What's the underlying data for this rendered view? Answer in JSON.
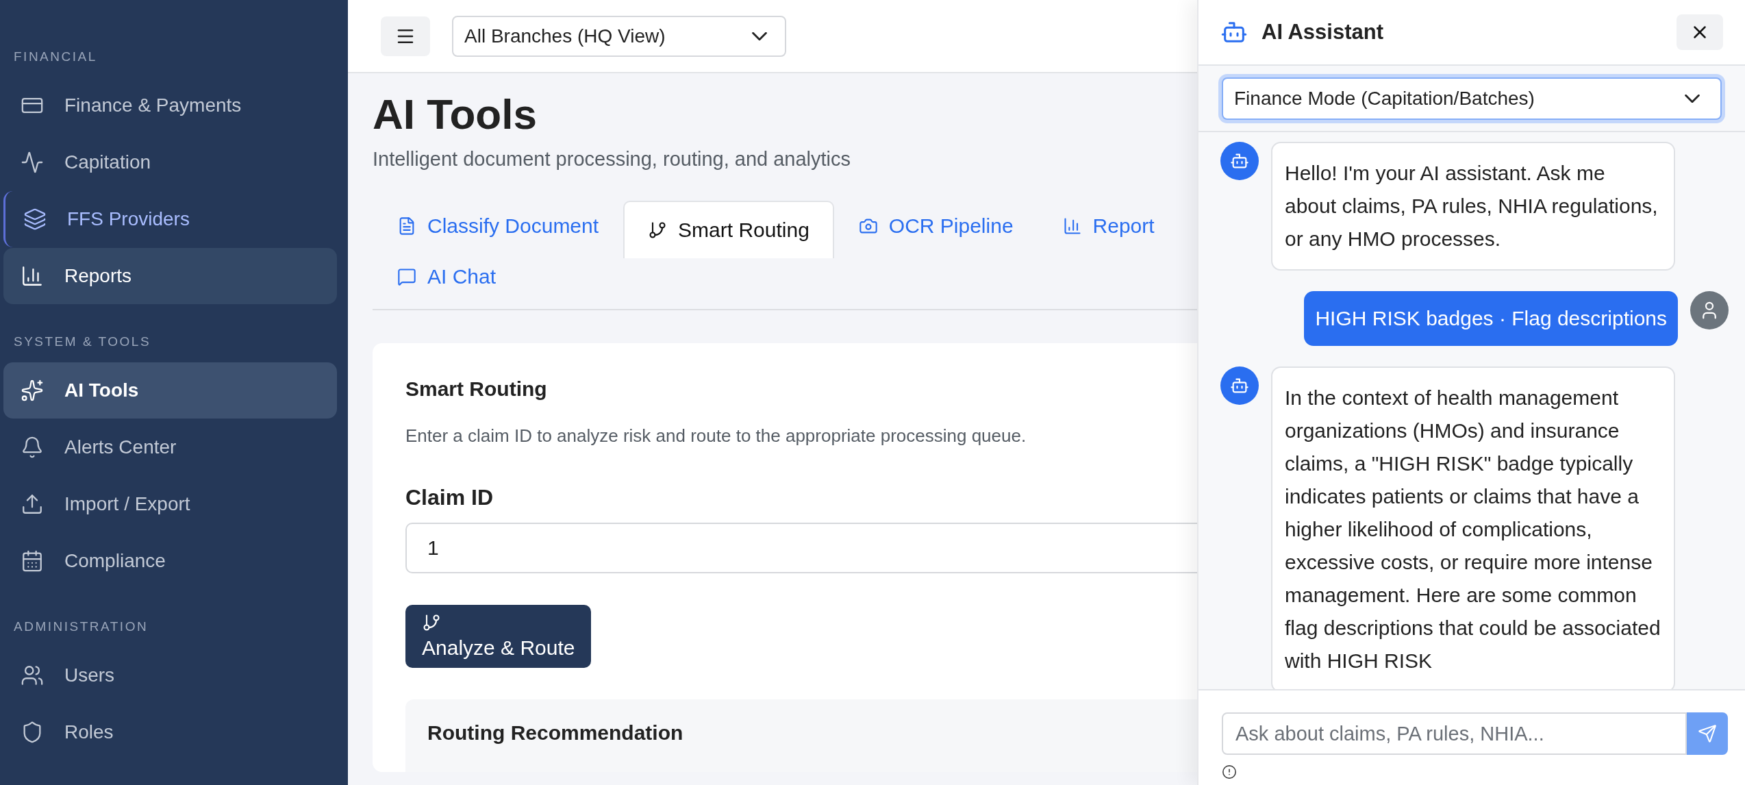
{
  "sidebar": {
    "sections": [
      {
        "title": "FINANCIAL",
        "items": [
          {
            "label": "Finance & Payments",
            "selected": false,
            "hovered": false,
            "focused": false
          },
          {
            "label": "Capitation",
            "selected": false,
            "hovered": false,
            "focused": false
          },
          {
            "label": "FFS Providers",
            "selected": false,
            "hovered": false,
            "focused": true
          },
          {
            "label": "Reports",
            "selected": false,
            "hovered": true,
            "focused": false
          }
        ]
      },
      {
        "title": "SYSTEM & TOOLS",
        "items": [
          {
            "label": "AI Tools",
            "selected": true,
            "hovered": false,
            "focused": false
          },
          {
            "label": "Alerts Center",
            "selected": false,
            "hovered": false,
            "focused": false
          },
          {
            "label": "Import / Export",
            "selected": false,
            "hovered": false,
            "focused": false
          },
          {
            "label": "Compliance",
            "selected": false,
            "hovered": false,
            "focused": false
          }
        ]
      },
      {
        "title": "ADMINISTRATION",
        "items": [
          {
            "label": "Users",
            "selected": false,
            "hovered": false,
            "focused": false
          },
          {
            "label": "Roles",
            "selected": false,
            "hovered": false,
            "focused": false
          }
        ]
      }
    ]
  },
  "topbar": {
    "branch_select": {
      "value": "All Branches (HQ View)"
    }
  },
  "page": {
    "title": "AI Tools",
    "subtitle": "Intelligent document processing, routing, and analytics"
  },
  "tabs": [
    {
      "label": "Classify Document",
      "selected": false
    },
    {
      "label": "Smart Routing",
      "selected": true
    },
    {
      "label": "OCR Pipeline",
      "selected": false
    },
    {
      "label": "Report",
      "selected": false
    },
    {
      "label": "AI Chat",
      "selected": false
    }
  ],
  "smart_routing": {
    "title": "Smart Routing",
    "description": "Enter a claim ID to analyze risk and route to the appropriate processing queue.",
    "claim_id": {
      "label": "Claim ID",
      "value": "1"
    },
    "button": "Analyze & Route",
    "result_title": "Routing Recommendation"
  },
  "assistant": {
    "title": "AI Assistant",
    "mode_select": {
      "value": "Finance Mode (Capitation/Batches)"
    },
    "messages": [
      {
        "kind": "bot",
        "text": "Hello! I'm your AI assistant. Ask me about claims, PA rules, NHIA regulations, or any HMO processes."
      },
      {
        "kind": "user",
        "text": "HIGH RISK badges · Flag descriptions"
      },
      {
        "kind": "bot",
        "text": "In the context of health management organizations (HMOs) and insurance claims, a \"HIGH RISK\" badge typically indicates patients or claims that have a higher likelihood of complications, excessive costs, or require more intense management. Here are some common flag descriptions that could be associated with HIGH RISK"
      }
    ],
    "input": {
      "placeholder": "Ask about claims, PA rules, NHIA..."
    }
  }
}
